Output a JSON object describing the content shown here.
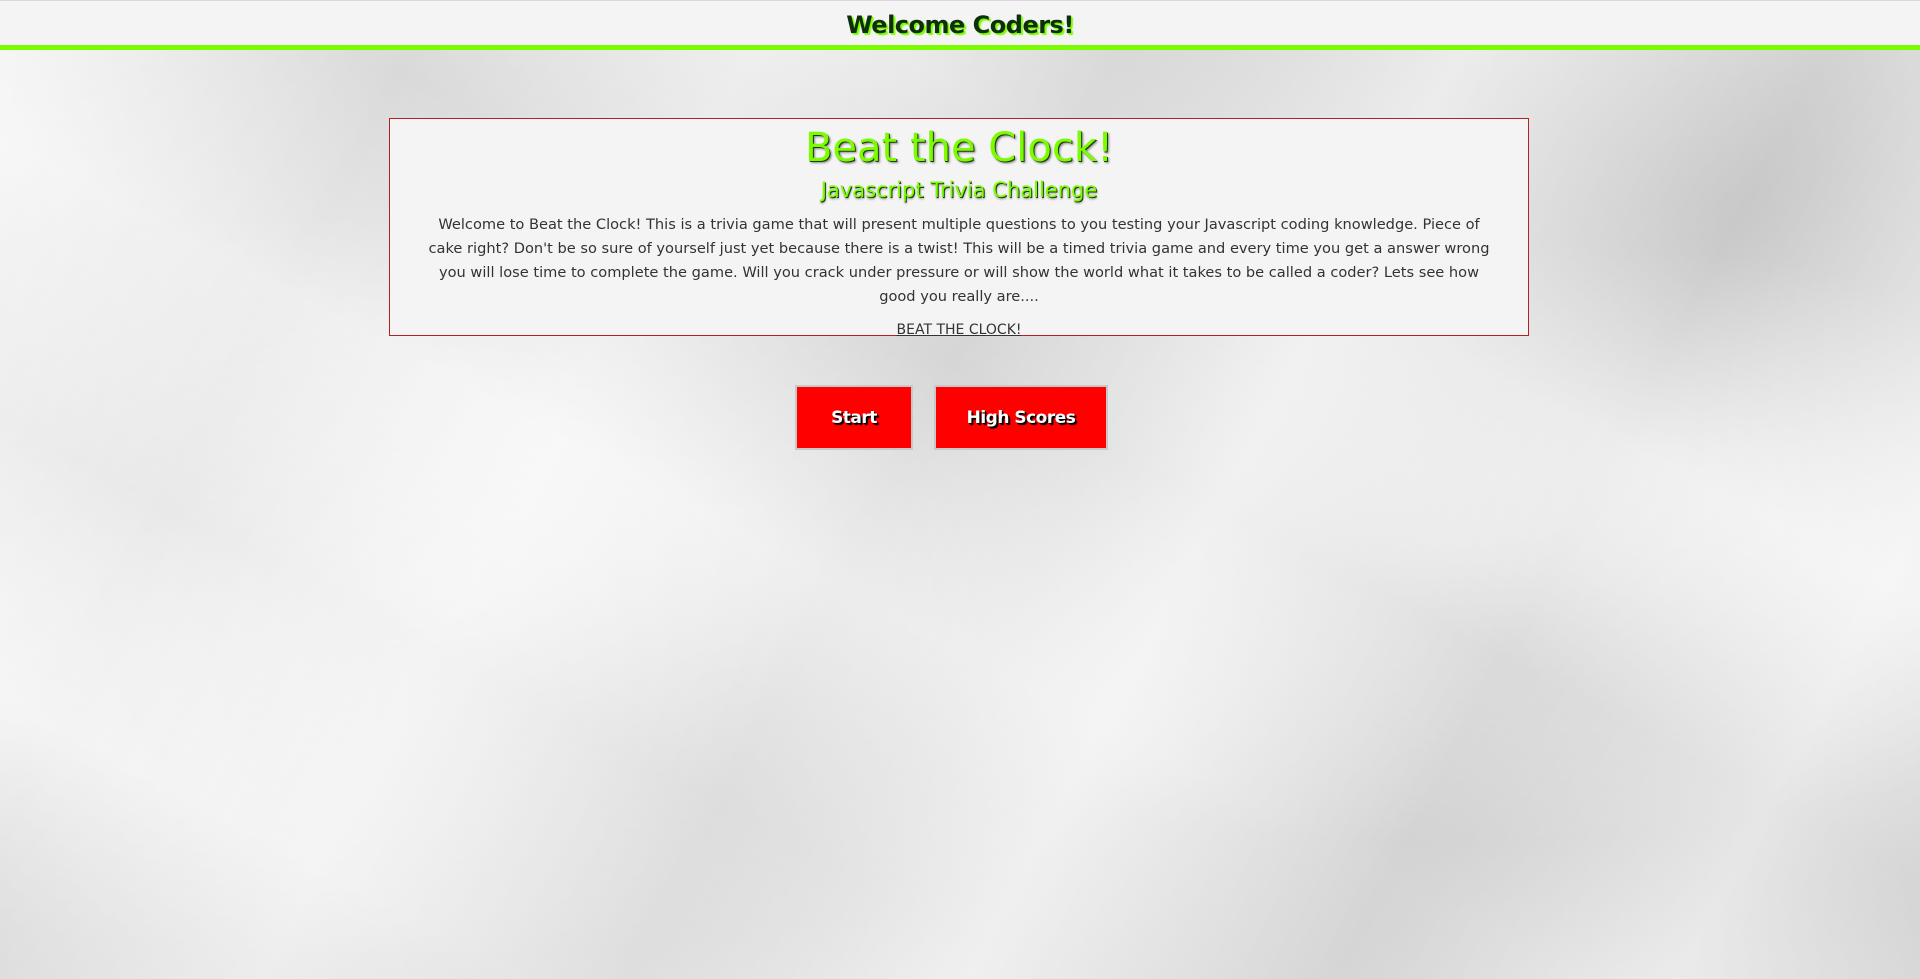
{
  "header": {
    "title": "Welcome Coders!"
  },
  "intro": {
    "title": "Beat the Clock!",
    "subtitle": "Javascript Trivia Challenge",
    "body": "Welcome to Beat the Clock! This is a trivia game that will present multiple questions to you testing your Javascript coding knowledge. Piece of cake right? Don't be so sure of yourself just yet because there is a twist! This will be a timed trivia game and every time you get a answer wrong you will lose time to complete the game. Will you crack under pressure or will show the world what it takes to be called a coder? Lets see how good you really are....",
    "link_text": "BEAT THE CLOCK!"
  },
  "actions": {
    "start_label": "Start",
    "high_scores_label": "High Scores"
  },
  "colors": {
    "accent_green": "#7cfc00",
    "button_red": "#ff0000",
    "card_border": "#b22222",
    "panel_bg": "#f4f4f4"
  }
}
